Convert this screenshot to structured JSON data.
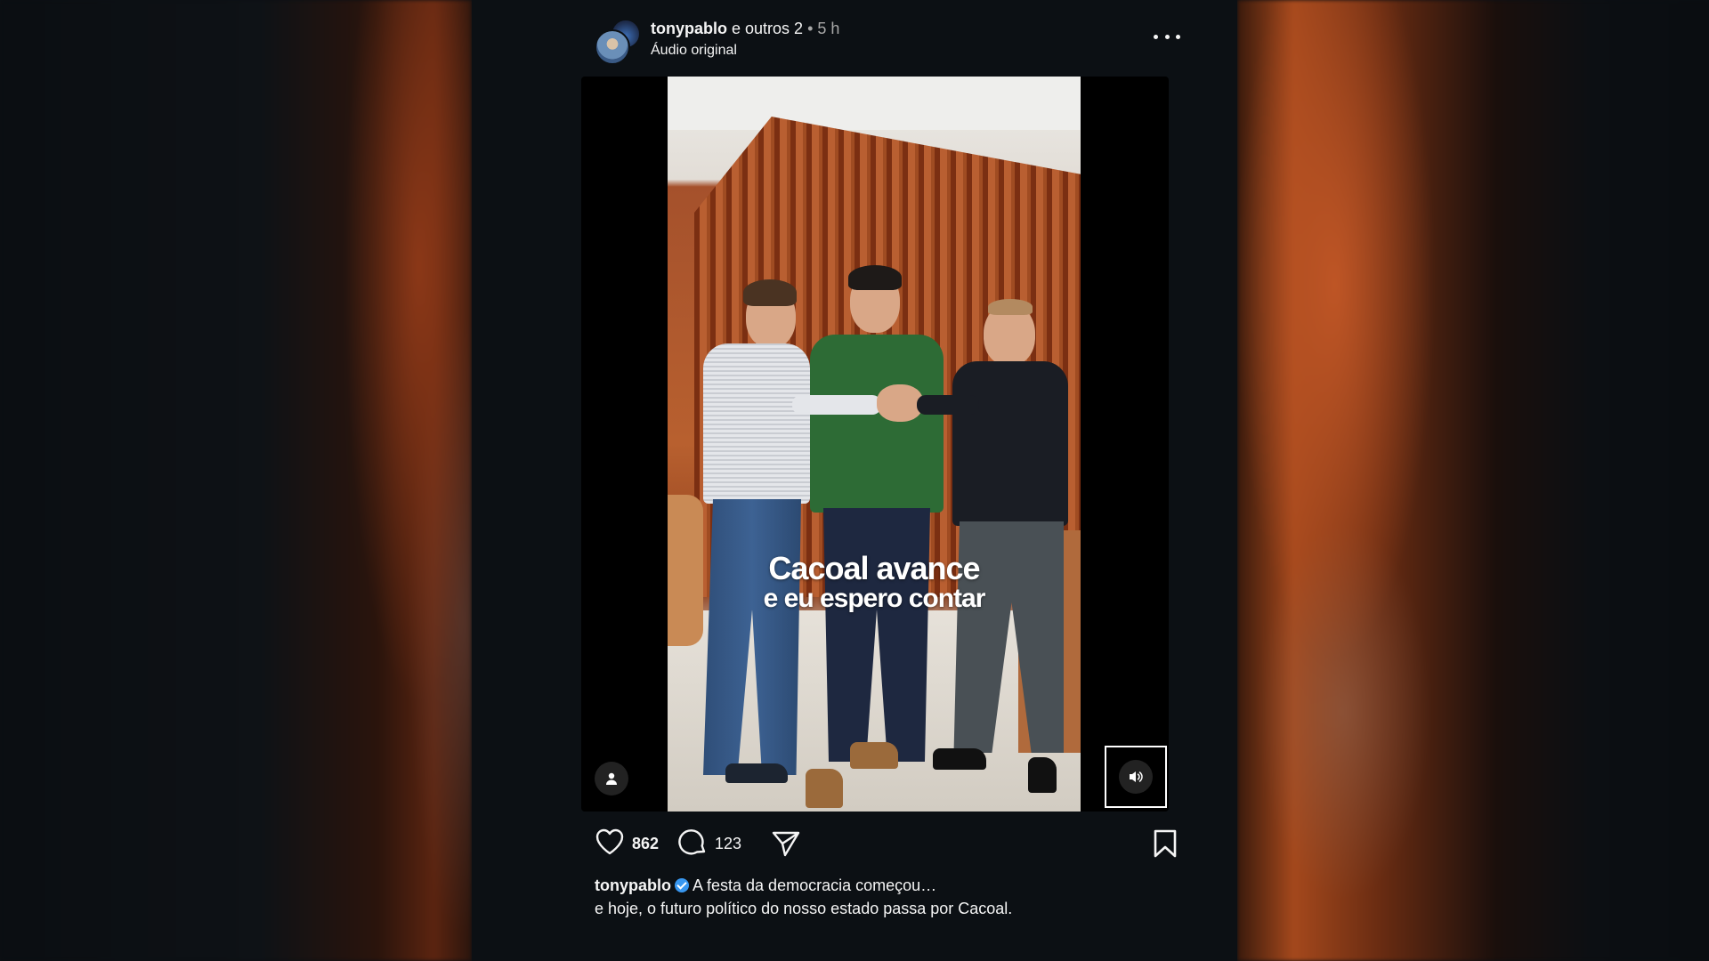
{
  "post": {
    "username": "tonypablo",
    "coauthors": "e outros 2",
    "separator": " • ",
    "time": "5 h",
    "audio": "Áudio original"
  },
  "video": {
    "caption_line1": "Cacoal avance",
    "caption_line2": "e eu espero contar"
  },
  "actions": {
    "likes": "862",
    "comments": "123"
  },
  "caption": {
    "username": "tonypablo",
    "line1": "A festa da democracia começou…",
    "line2": "e hoje, o futuro político do nosso estado passa por Cacoal."
  },
  "colors": {
    "background": "#0c1014",
    "verified": "#3897f0",
    "text": "#f5f5f5",
    "muted": "#a8a8a8"
  },
  "icons": [
    "more-options-icon",
    "user-tag-icon",
    "volume-icon",
    "heart-icon",
    "comment-icon",
    "share-icon",
    "bookmark-icon",
    "verified-badge-icon"
  ]
}
